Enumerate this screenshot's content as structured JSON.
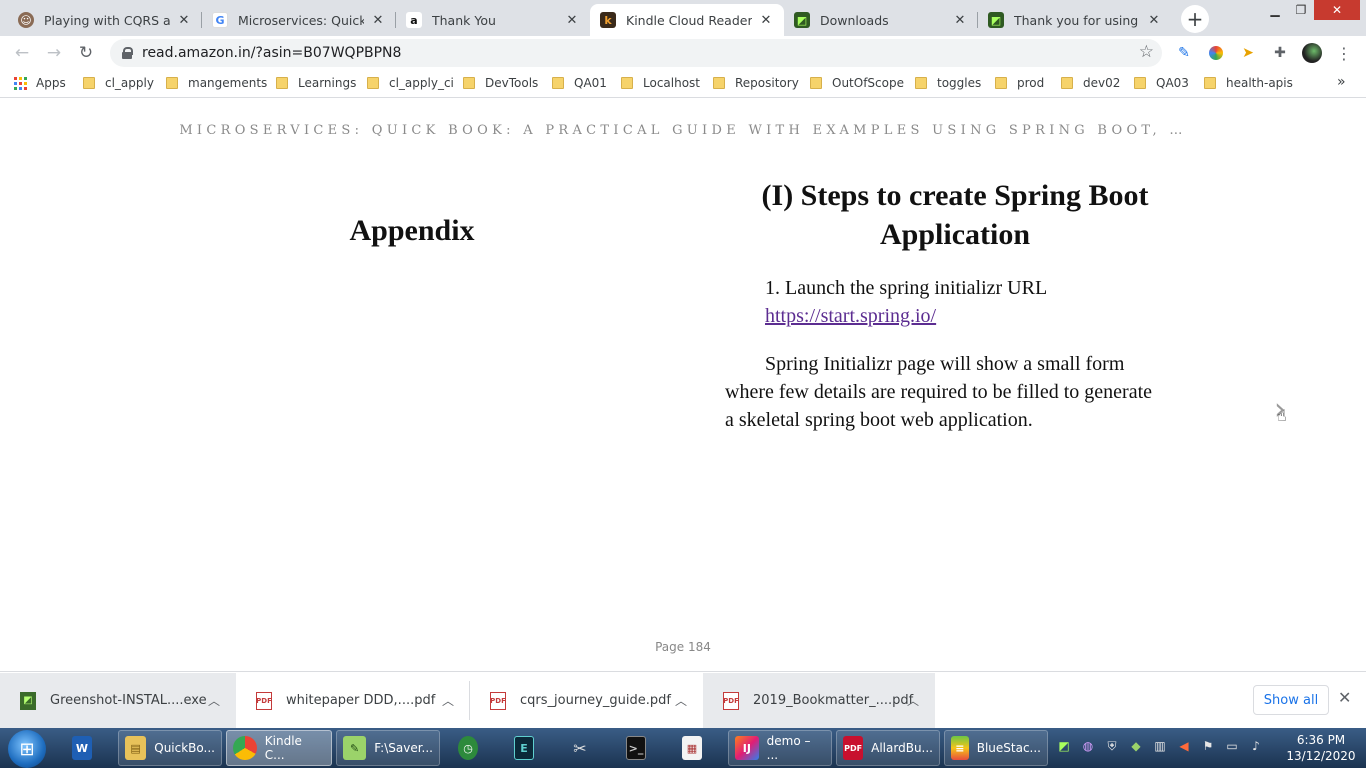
{
  "tabs": [
    {
      "title": "Playing with CQRS and E",
      "favicon": "avatar-icon",
      "active": false
    },
    {
      "title": "Microservices: Quick Boo",
      "favicon": "google-icon",
      "active": false
    },
    {
      "title": "Thank You",
      "favicon": "amazon-icon",
      "active": false
    },
    {
      "title": "Kindle Cloud Reader",
      "favicon": "kindle-icon",
      "active": true
    },
    {
      "title": "Downloads",
      "favicon": "greenshot-icon",
      "active": false
    },
    {
      "title": "Thank you for using Gree",
      "favicon": "greenshot-icon",
      "active": false
    }
  ],
  "address": {
    "url": "read.amazon.in/?asin=B07WQPBPN8"
  },
  "bookmarks": {
    "apps_label": "Apps",
    "items": [
      "cl_apply",
      "mangements",
      "Learnings",
      "cl_apply_ci",
      "DevTools",
      "QA01",
      "Localhost",
      "Repository",
      "OutOfScope",
      "toggles",
      "prod",
      "dev02",
      "QA03",
      "health-apis"
    ],
    "overflow": "»"
  },
  "reader": {
    "book_title": "MICROSERVICES: QUICK BOOK: A PRACTICAL GUIDE WITH EXAMPLES USING SPRING BOOT, …",
    "left_heading": "Appendix",
    "right_heading": "(I) Steps to create Spring Boot Application",
    "step_text": "1. Launch the spring initializr URL",
    "step_link": "https://start.spring.io/",
    "paragraph": "Spring Initializr page will show a small form where few details are required to be filled to generate a skeletal spring boot web application.",
    "page_label": "Page 184",
    "next_arrow": "›"
  },
  "downloads": {
    "items": [
      {
        "name": "Greenshot-INSTAL....exe",
        "type": "exe"
      },
      {
        "name": "whitepaper DDD,....pdf",
        "type": "pdf"
      },
      {
        "name": "cqrs_journey_guide.pdf",
        "type": "pdf"
      },
      {
        "name": "2019_Bookmatter_....pdf",
        "type": "pdf"
      }
    ],
    "show_all": "Show all"
  },
  "taskbar": {
    "items": [
      "QuickBo...",
      "Kindle C...",
      "F:\\Saver...",
      "demo – ...",
      "AllardBu...",
      "BlueStac..."
    ],
    "time": "6:36 PM",
    "date": "13/12/2020"
  },
  "colors": {
    "link": "#5c2d91",
    "tab_strip": "#dee1e6",
    "taskbar": "#1b3350"
  }
}
